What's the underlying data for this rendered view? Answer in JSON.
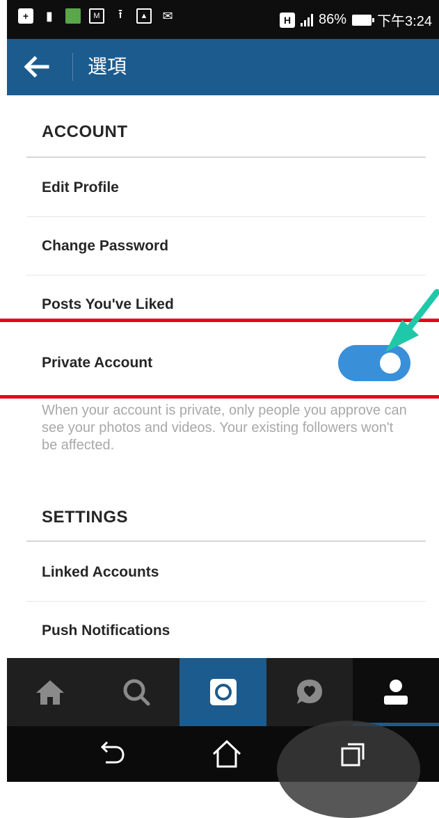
{
  "status_bar": {
    "battery": "86%",
    "time": "下午3:24",
    "network": "H",
    "icons": [
      "plus-box-icon",
      "sd-card-icon",
      "gallery-icon",
      "image-icon",
      "upload-icon",
      "photo-icon",
      "mail-icon",
      "network-h-icon",
      "signal-icon",
      "battery-icon"
    ]
  },
  "appbar": {
    "title": "選項",
    "back_icon": "arrow-left-icon"
  },
  "sections": {
    "account": {
      "header": "ACCOUNT",
      "items": [
        {
          "label": "Edit Profile"
        },
        {
          "label": "Change Password"
        },
        {
          "label": "Posts You've Liked"
        },
        {
          "label": "Private Account"
        }
      ],
      "private_account_on": true,
      "private_description": "When your account is private, only people you approve can see your photos and videos. Your existing followers won't be affected."
    },
    "settings": {
      "header": "SETTINGS",
      "items": [
        {
          "label": "Linked Accounts"
        },
        {
          "label": "Push Notifications"
        }
      ]
    }
  },
  "tabbar": {
    "tabs": [
      {
        "icon": "home-icon"
      },
      {
        "icon": "search-icon"
      },
      {
        "icon": "camera-icon",
        "active": true
      },
      {
        "icon": "activity-bubble-icon"
      },
      {
        "icon": "profile-icon"
      }
    ]
  },
  "navbar": {
    "buttons": [
      "back-nav-icon",
      "home-nav-icon",
      "recents-icon"
    ]
  },
  "colors": {
    "brand": "#1c5b8e",
    "toggle_on": "#3a8fd9",
    "annotation_red": "#e8001c",
    "annotation_arrow": "#1fc8a8"
  }
}
